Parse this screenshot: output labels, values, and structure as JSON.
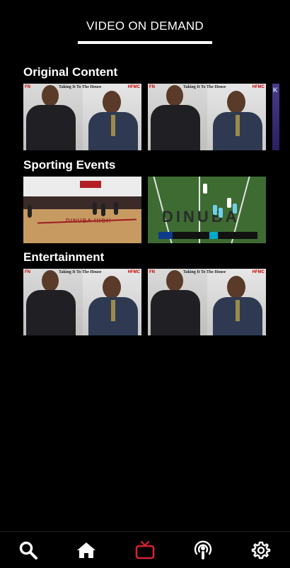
{
  "header": {
    "title": "VIDEO ON DEMAND"
  },
  "sections": [
    {
      "title": "Original Content",
      "items": [
        {
          "kind": "podcast",
          "show": "Taking It To The House",
          "logo_left": "FN",
          "logo_right": "HFMC"
        },
        {
          "kind": "podcast",
          "show": "Taking It To The House",
          "logo_left": "FN",
          "logo_right": "HFMC"
        }
      ]
    },
    {
      "title": "Sporting Events",
      "items": [
        {
          "kind": "basketball",
          "court_text": "DINUBA HIGH"
        },
        {
          "kind": "football",
          "field_text": "DINUBA"
        }
      ]
    },
    {
      "title": "Entertainment",
      "items": [
        {
          "kind": "podcast",
          "show": "Taking It To The House",
          "logo_left": "FN",
          "logo_right": "HFMC"
        },
        {
          "kind": "podcast",
          "show": "Taking It To The House",
          "logo_left": "FN",
          "logo_right": "HFMC"
        }
      ]
    }
  ],
  "bottom_nav": {
    "items": [
      {
        "icon": "search-icon"
      },
      {
        "icon": "home-icon"
      },
      {
        "icon": "tv-icon",
        "active": true
      },
      {
        "icon": "podcast-icon"
      },
      {
        "icon": "settings-icon"
      }
    ],
    "active_color": "#d8232a",
    "inactive_color": "#ffffff"
  }
}
